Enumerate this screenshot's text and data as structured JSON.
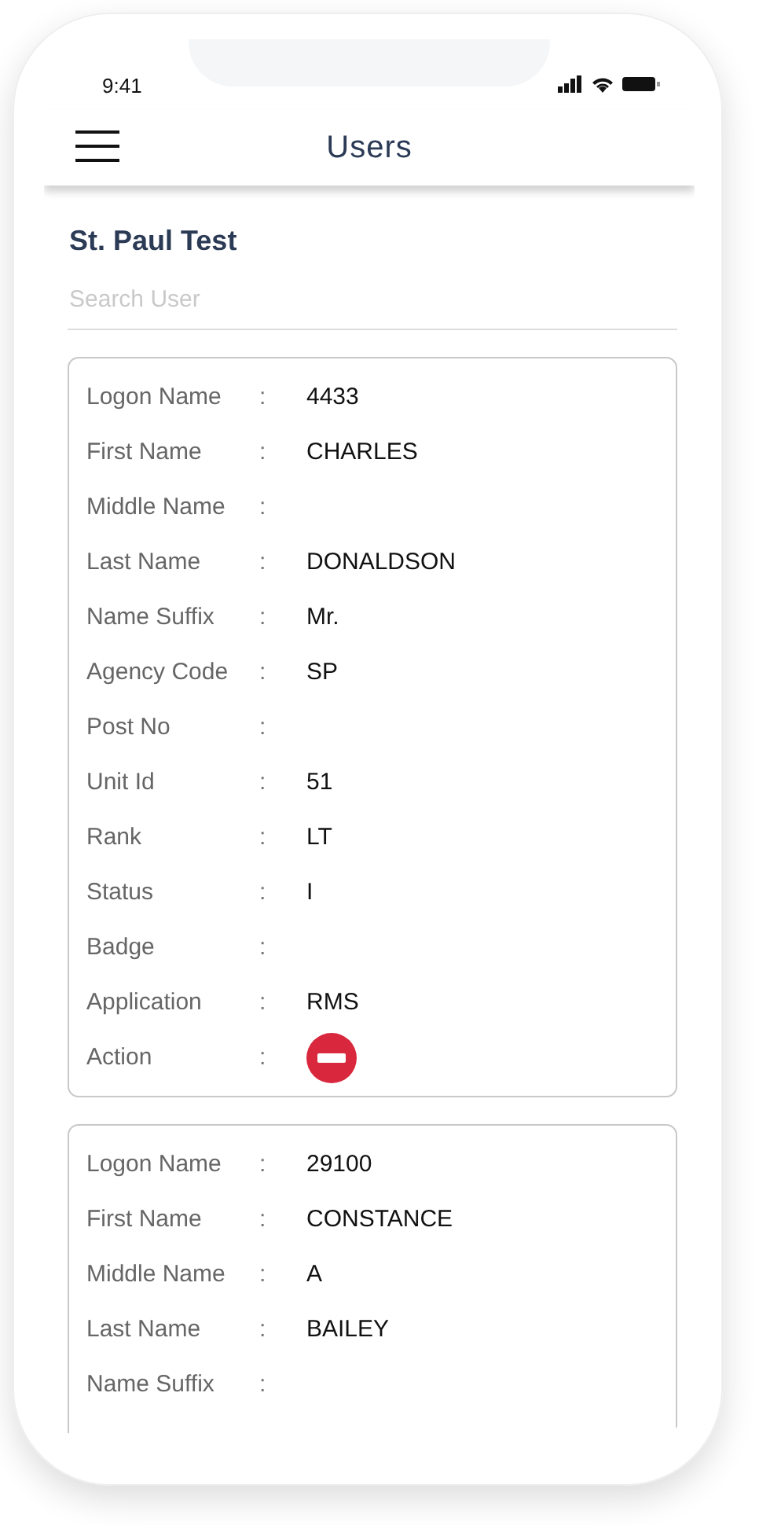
{
  "status_bar": {
    "time": "9:41"
  },
  "header": {
    "title": "Users"
  },
  "agency": {
    "title": "St. Paul Test"
  },
  "search": {
    "placeholder": "Search User"
  },
  "users": [
    {
      "fields": [
        {
          "kind": "text",
          "label": "Logon Name",
          "separator": ":",
          "value": "4433"
        },
        {
          "kind": "text",
          "label": "First Name",
          "separator": ":",
          "value": "CHARLES"
        },
        {
          "kind": "text",
          "label": "Middle Name",
          "separator": ":"
        },
        {
          "kind": "text",
          "label": "Last Name",
          "separator": ":",
          "value": "DONALDSON"
        },
        {
          "kind": "text",
          "label": "Name Suffix",
          "separator": ":",
          "value": "Mr."
        },
        {
          "kind": "text",
          "label": "Agency Code",
          "separator": ":",
          "value": "SP"
        },
        {
          "kind": "text",
          "label": "Post No",
          "separator": ":"
        },
        {
          "kind": "text",
          "label": "Unit Id",
          "separator": ":",
          "value": "51"
        },
        {
          "kind": "text",
          "label": "Rank",
          "separator": ":",
          "value": "LT"
        },
        {
          "kind": "text",
          "label": "Status",
          "separator": ":",
          "value": "I"
        },
        {
          "kind": "text",
          "label": "Badge",
          "separator": ":"
        },
        {
          "kind": "text",
          "label": "Application",
          "separator": ":",
          "value": "RMS"
        },
        {
          "kind": "action",
          "label": "Action",
          "separator": ":"
        }
      ]
    },
    {
      "fields": [
        {
          "kind": "text",
          "label": "Logon Name",
          "separator": ":",
          "value": "29100"
        },
        {
          "kind": "text",
          "label": "First Name",
          "separator": ":",
          "value": "CONSTANCE"
        },
        {
          "kind": "text",
          "label": "Middle Name",
          "separator": ":",
          "value": "A"
        },
        {
          "kind": "text",
          "label": "Last Name",
          "separator": ":",
          "value": "BAILEY"
        },
        {
          "kind": "text",
          "label": "Name Suffix",
          "separator": ":"
        }
      ]
    }
  ]
}
